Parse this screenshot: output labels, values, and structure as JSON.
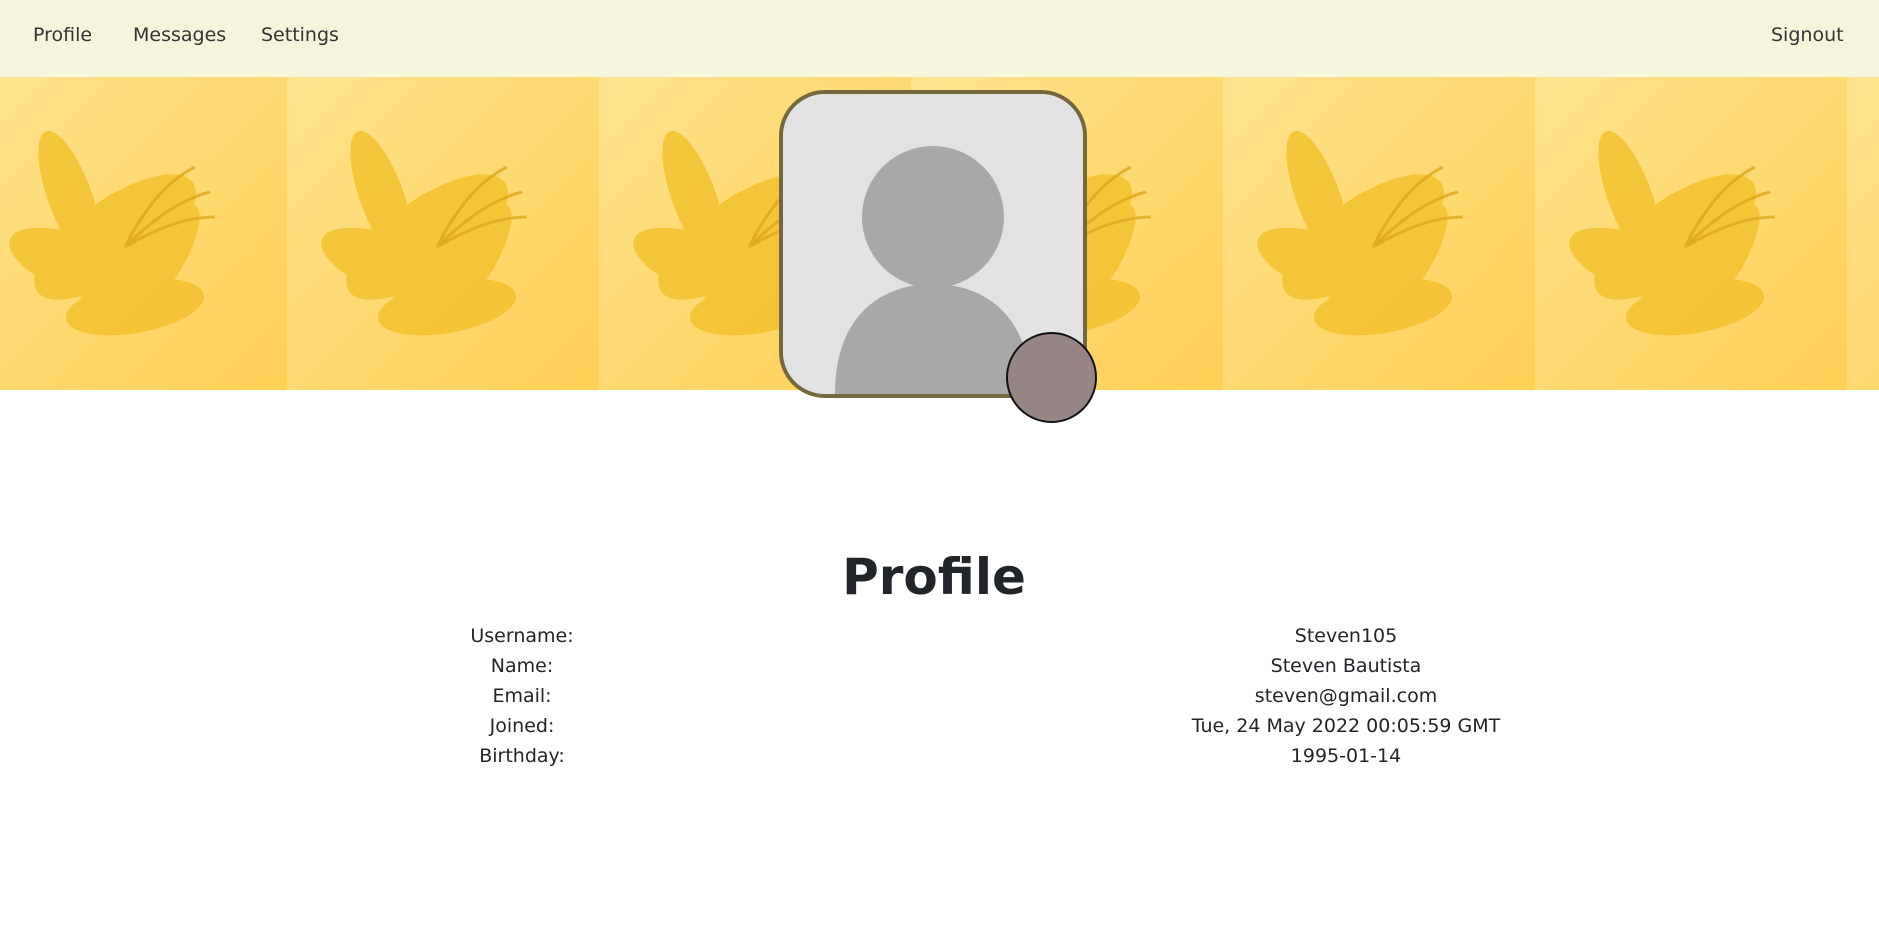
{
  "nav": {
    "left_links": [
      "Profile",
      "Messages",
      "Settings"
    ],
    "signout_label": "Signout"
  },
  "banner": {
    "image": "yellow-lily-tiled-pattern",
    "background_color": "#ffd86a"
  },
  "avatar": {
    "icon": "default-user-avatar-icon",
    "border_color": "#75683e",
    "status_dot_color": "#978585"
  },
  "profile": {
    "title": "Profile",
    "fields": [
      {
        "label": "Username:",
        "value": "Steven105"
      },
      {
        "label": "Name:",
        "value": "Steven Bautista"
      },
      {
        "label": "Email:",
        "value": "steven@gmail.com"
      },
      {
        "label": "Joined:",
        "value": "Tue, 24 May 2022 00:05:59 GMT"
      },
      {
        "label": "Birthday:",
        "value": "1995-01-14"
      }
    ]
  }
}
